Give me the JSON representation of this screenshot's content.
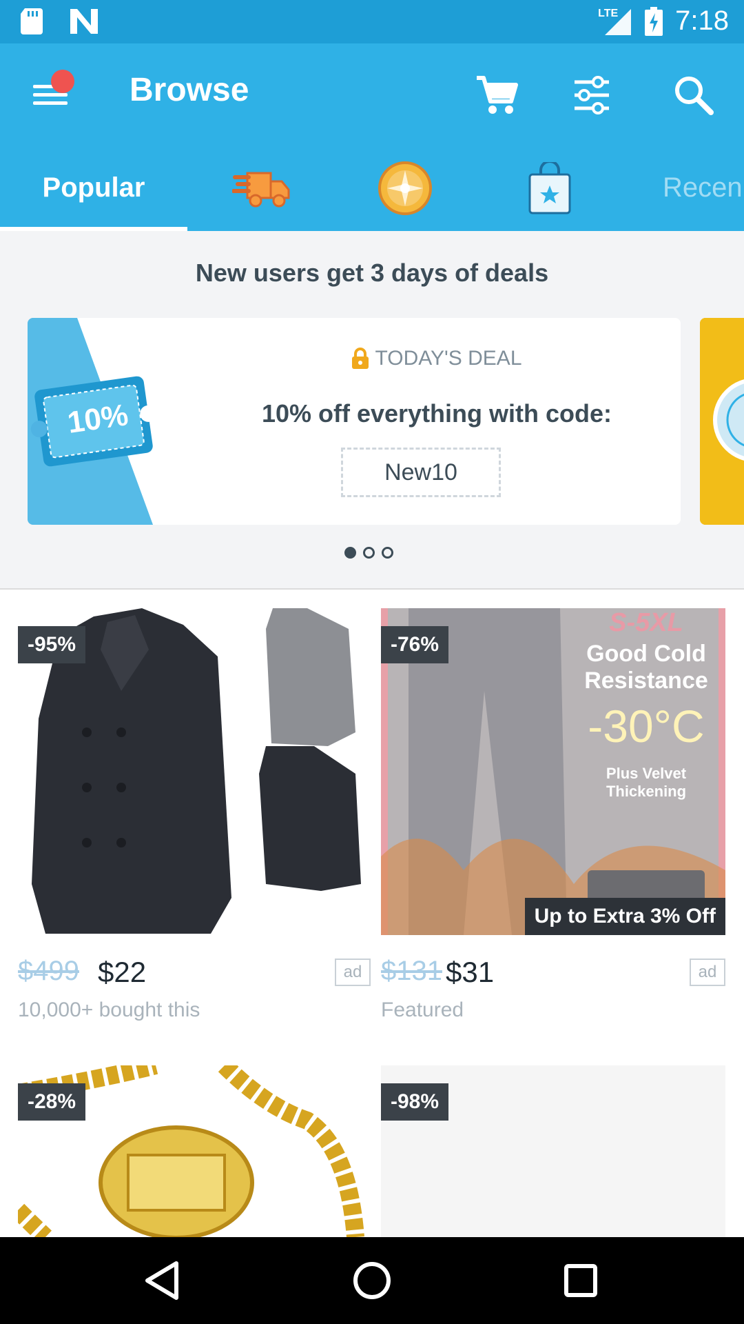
{
  "status_bar": {
    "time": "7:18",
    "network": "LTE",
    "icons": [
      "sd-card-icon",
      "n-notification-icon",
      "signal-icon",
      "battery-charging-icon"
    ]
  },
  "app_bar": {
    "title": "Browse",
    "actions": [
      "cart-icon",
      "filter-icon",
      "search-icon"
    ],
    "menu_has_notification": true
  },
  "tabs": [
    {
      "label": "Popular",
      "selected": true
    },
    {
      "icon": "fast-shipping-icon"
    },
    {
      "icon": "lucky-wheel-icon"
    },
    {
      "icon": "shopping-bag-star-icon"
    },
    {
      "label": "Recen"
    }
  ],
  "promo": {
    "headline": "New users get 3 days of deals",
    "coupon_label": "10%",
    "deal_label": "TODAY'S DEAL",
    "deal_text": "10% off everything with code:",
    "code": "New10",
    "carousel_pages": 3,
    "carousel_active": 0
  },
  "products": [
    {
      "discount": "-95%",
      "old_price": "$499",
      "price": "$22",
      "ad": "ad",
      "subtitle": "10,000+ bought this"
    },
    {
      "discount": "-76%",
      "old_price": "$131",
      "price": "$31",
      "ad": "ad",
      "subtitle": "Featured",
      "promo_tag": "Up to Extra 3% Off",
      "image_text": {
        "size": "S-5XL",
        "line1": "Good Cold",
        "line2": "Resistance",
        "temp": "-30°C",
        "line3": "Plus Velvet",
        "line4": "Thickening"
      }
    },
    {
      "discount": "-28%"
    },
    {
      "discount": "-98%"
    }
  ],
  "colors": {
    "primary": "#2fb1e6",
    "status": "#1e9ed6",
    "text": "#3c4c57",
    "accent_gold": "#f0b614"
  }
}
